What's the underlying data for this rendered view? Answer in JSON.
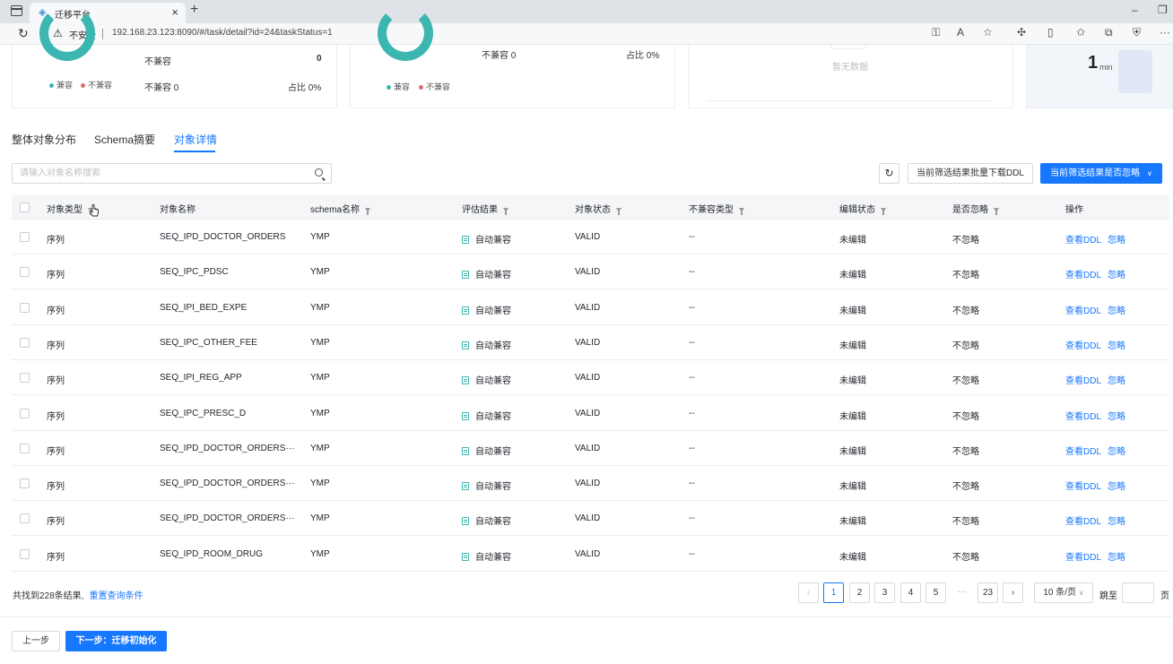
{
  "browser": {
    "tab_title": "迁移平台",
    "tab_close": "×",
    "new_tab": "+",
    "insecure_label": "不安全",
    "url": "192.168.23.123:8090/#/task/detail?id=24&taskStatus=1"
  },
  "cards": {
    "card1": {
      "legend_compat": "兼容",
      "legend_incompat": "不兼容",
      "incompat_label": "不兼容",
      "incompat_value": "0",
      "incompat_count": "不兼容 0",
      "ratio": "占比 0%"
    },
    "card2": {
      "incompat_count": "不兼容 0",
      "ratio": "占比 0%",
      "legend_compat": "兼容",
      "legend_incompat": "不兼容"
    },
    "card3": {
      "empty": "暂无数据"
    },
    "card4": {
      "value": "1",
      "unit": "min"
    }
  },
  "tabs": [
    "整体对象分布",
    "Schema摘要",
    "对象详情"
  ],
  "search": {
    "placeholder": "请输入对象名称搜索"
  },
  "toolbar": {
    "download_ddl": "当前筛选结果批量下载DDL",
    "ignore_dropdown": "当前筛选结果是否忽略"
  },
  "table": {
    "columns": [
      "对象类型",
      "对象名称",
      "schema名称",
      "评估结果",
      "对象状态",
      "不兼容类型",
      "编辑状态",
      "是否忽略",
      "操作"
    ],
    "rows": [
      [
        "序列",
        "SEQ_IPD_DOCTOR_ORDERS",
        "YMP",
        "自动兼容",
        "VALID",
        "--",
        "未编辑",
        "不忽略"
      ],
      [
        "序列",
        "SEQ_IPC_PDSC",
        "YMP",
        "自动兼容",
        "VALID",
        "--",
        "未编辑",
        "不忽略"
      ],
      [
        "序列",
        "SEQ_IPI_BED_EXPE",
        "YMP",
        "自动兼容",
        "VALID",
        "--",
        "未编辑",
        "不忽略"
      ],
      [
        "序列",
        "SEQ_IPC_OTHER_FEE",
        "YMP",
        "自动兼容",
        "VALID",
        "--",
        "未编辑",
        "不忽略"
      ],
      [
        "序列",
        "SEQ_IPI_REG_APP",
        "YMP",
        "自动兼容",
        "VALID",
        "--",
        "未编辑",
        "不忽略"
      ],
      [
        "序列",
        "SEQ_IPC_PRESC_D",
        "YMP",
        "自动兼容",
        "VALID",
        "--",
        "未编辑",
        "不忽略"
      ],
      [
        "序列",
        "SEQ_IPD_DOCTOR_ORDERS···",
        "YMP",
        "自动兼容",
        "VALID",
        "--",
        "未编辑",
        "不忽略"
      ],
      [
        "序列",
        "SEQ_IPD_DOCTOR_ORDERS···",
        "YMP",
        "自动兼容",
        "VALID",
        "--",
        "未编辑",
        "不忽略"
      ],
      [
        "序列",
        "SEQ_IPD_DOCTOR_ORDERS···",
        "YMP",
        "自动兼容",
        "VALID",
        "--",
        "未编辑",
        "不忽略"
      ],
      [
        "序列",
        "SEQ_IPD_ROOM_DRUG",
        "YMP",
        "自动兼容",
        "VALID",
        "--",
        "未编辑",
        "不忽略"
      ]
    ],
    "action_view": "查看DDL",
    "action_ignore": "忽略"
  },
  "footer": {
    "total": "共找到228条结果,",
    "reset": "重置查询条件",
    "pages": [
      "1",
      "2",
      "3",
      "4",
      "5",
      "···",
      "23"
    ],
    "page_size": "10 条/页",
    "jump_label": "跳至",
    "page_unit": "页"
  },
  "nav": {
    "prev": "上一步",
    "next": "下一步：迁移初始化"
  }
}
